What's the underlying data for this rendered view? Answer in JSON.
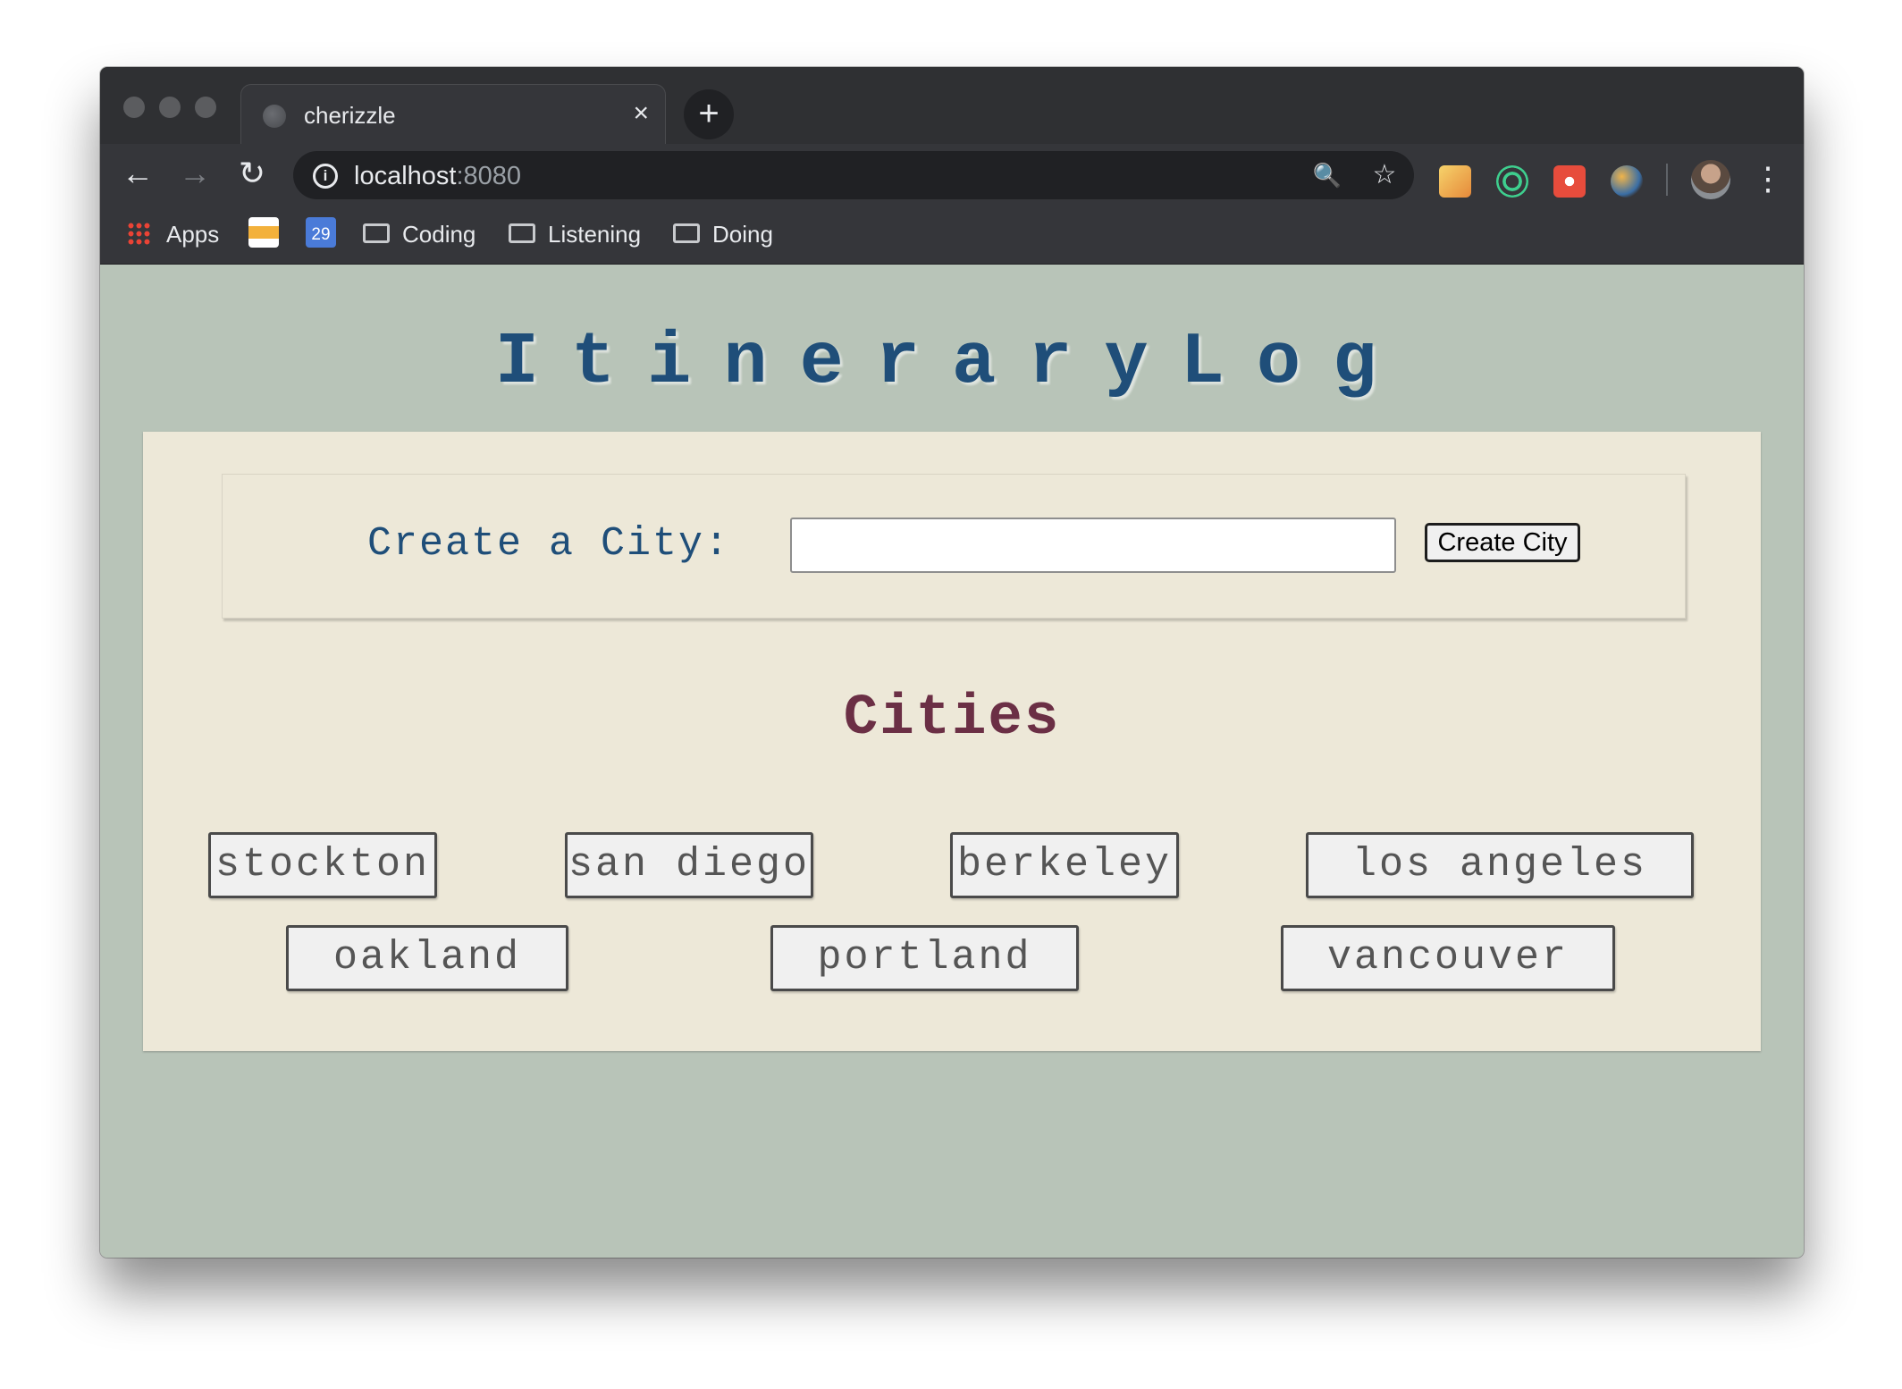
{
  "browser": {
    "tab_title": "cherizzle",
    "tab_close": "×",
    "new_tab": "+",
    "back": "←",
    "forward": "→",
    "reload": "↻",
    "url_host": "localhost",
    "url_port": ":8080",
    "info": "i",
    "zoom": "🔍",
    "star": "☆",
    "menu": "⋮",
    "bookmarks": {
      "apps": "Apps",
      "calendar_day": "29",
      "folders": [
        "Coding",
        "Listening",
        "Doing"
      ]
    }
  },
  "page": {
    "title": "ItineraryLog",
    "create_label": "Create a City:",
    "create_input_value": "",
    "create_button": "Create City",
    "cities_heading": "Cities",
    "cities": [
      "stockton",
      "san diego",
      "berkeley",
      "los angeles",
      "oakland",
      "portland",
      "vancouver"
    ]
  },
  "colors": {
    "page_bg": "#b8c4b8",
    "panel_bg": "#ede8d8",
    "title": "#1f4e79",
    "cities_heading": "#6b2f45"
  }
}
